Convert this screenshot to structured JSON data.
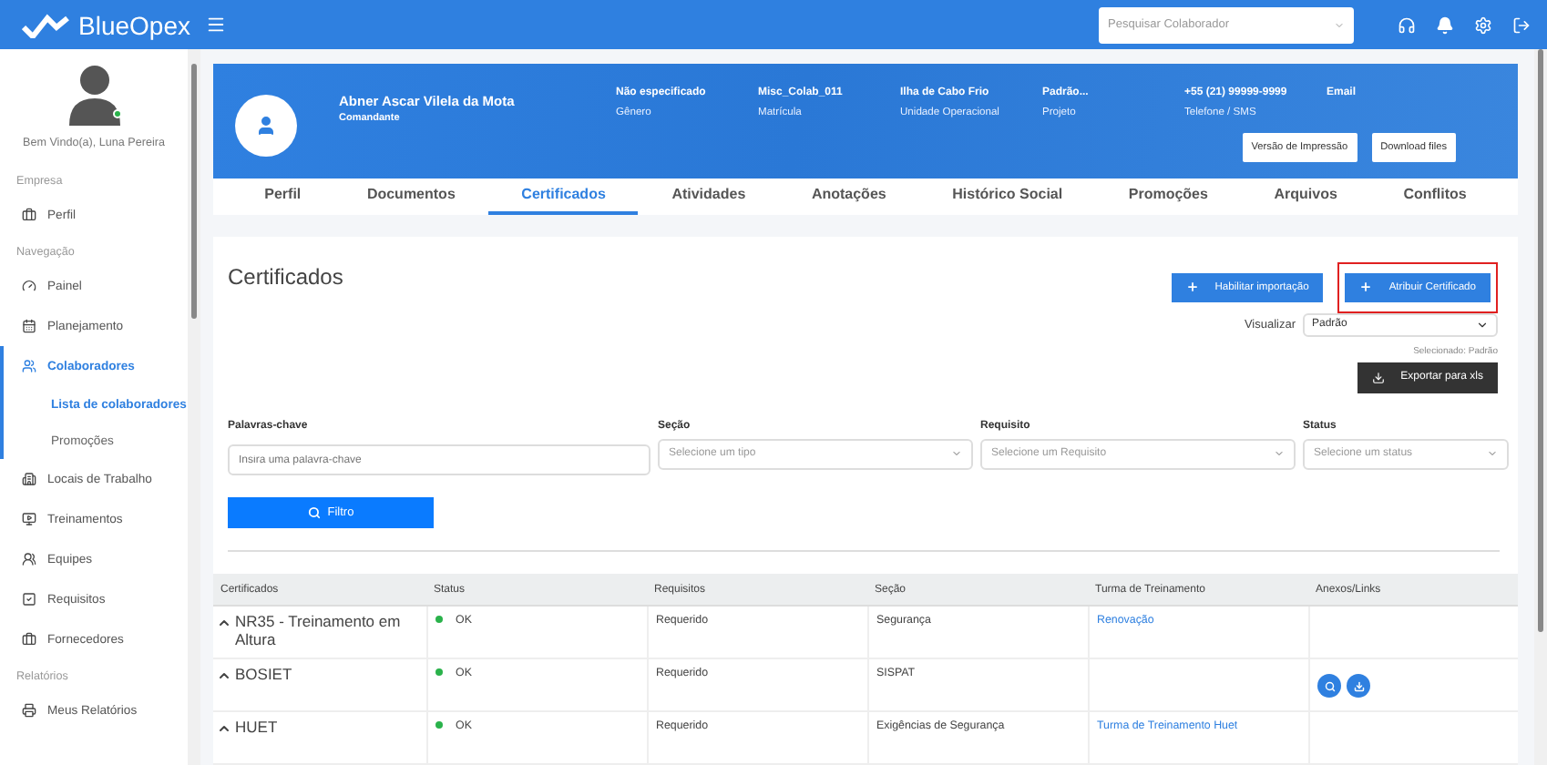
{
  "app": {
    "brand": "BlueOpex",
    "search": {
      "placeholder": "Pesquisar Colaborador"
    }
  },
  "sidebar": {
    "welcome": "Bem Vindo(a), Luna Pereira",
    "online": true,
    "sections": [
      {
        "title": "Empresa",
        "items": [
          {
            "label": "Perfil",
            "kind": "briefcase",
            "selected": false
          }
        ]
      },
      {
        "title": "Navegação",
        "items": [
          {
            "label": "Painel",
            "kind": "gauge",
            "selected": false
          },
          {
            "label": "Planejamento",
            "kind": "calendar",
            "selected": false
          },
          {
            "label": "Colaboradores",
            "kind": "users",
            "selected": true,
            "children": [
              {
                "label": "Lista de colaboradores",
                "selected": true
              },
              {
                "label": "Promoções",
                "selected": false
              }
            ]
          },
          {
            "label": "Locais de Trabalho",
            "kind": "building",
            "selected": false
          },
          {
            "label": "Treinamentos",
            "kind": "monitor",
            "selected": false
          },
          {
            "label": "Equipes",
            "kind": "team",
            "selected": false
          },
          {
            "label": "Requisitos",
            "kind": "check",
            "selected": false
          },
          {
            "label": "Fornecedores",
            "kind": "briefcase",
            "selected": false
          }
        ]
      },
      {
        "title": "Relatórios",
        "items": [
          {
            "label": "Meus Relatórios",
            "kind": "printer",
            "selected": false
          }
        ]
      }
    ]
  },
  "profile": {
    "name": "Abner Ascar Vilela da Mota",
    "role": "Comandante",
    "fields": [
      {
        "value": "Não especificado",
        "label": "Gênero"
      },
      {
        "value": "Misc_Colab_011",
        "label": "Matrícula"
      },
      {
        "value": "Ilha de Cabo Frio",
        "label": "Unidade Operacional"
      },
      {
        "value": "Padrão...",
        "label": "Projeto"
      },
      {
        "value": "+55 (21) 99999-9999",
        "label": "Telefone / SMS"
      },
      {
        "value": "Email"
      }
    ],
    "buttons": [
      "Versão de Impressão",
      "Download files"
    ]
  },
  "tabs": [
    {
      "label": "Perfil",
      "selected": false
    },
    {
      "label": "Documentos",
      "selected": false
    },
    {
      "label": "Certificados",
      "selected": true
    },
    {
      "label": "Atividades",
      "selected": false
    },
    {
      "label": "Anotações",
      "selected": false
    },
    {
      "label": "Histórico Social",
      "selected": false
    },
    {
      "label": "Promoções",
      "selected": false
    },
    {
      "label": "Arquivos",
      "selected": false
    },
    {
      "label": "Conflitos",
      "selected": false
    }
  ],
  "page": {
    "title": "Certificados",
    "actions": [
      {
        "label": "Habilitar importação",
        "highlighted": false
      },
      {
        "label": "Atribuir Certificado",
        "highlighted": true
      }
    ],
    "view": {
      "label": "Visualizar",
      "value": "Padrão",
      "note": "Selecionado: Padrão"
    },
    "export": "Exportar para xls",
    "filters": [
      {
        "label": "Palavras-chave",
        "placeholder": "Insira uma palavra-chave",
        "kind": "text"
      },
      {
        "label": "Seção",
        "placeholder": "Selecione um tipo",
        "kind": "select"
      },
      {
        "label": "Requisito",
        "placeholder": "Selecione um Requisito",
        "kind": "select"
      },
      {
        "label": "Status",
        "placeholder": "Selecione um status",
        "kind": "select"
      }
    ],
    "filter_button": "Filtro"
  },
  "table": {
    "columns": [
      "Certificados",
      "Status",
      "Requisitos",
      "Seção",
      "Turma de Treinamento",
      "Anexos/Links"
    ],
    "rows": [
      {
        "name": "NR35 - Treinamento em Altura",
        "status": "OK",
        "requirement": "Requerido",
        "section": "Segurança",
        "training": "Renovação",
        "attachments": []
      },
      {
        "name": "BOSIET",
        "status": "OK",
        "requirement": "Requerido",
        "section": "SISPAT",
        "attachments": [
          {
            "kind": "view"
          },
          {
            "kind": "download"
          }
        ]
      },
      {
        "name": "HUET",
        "status": "OK",
        "requirement": "Requerido",
        "section": "Exigências de Segurança",
        "training": "Turma de Treinamento Huet",
        "attachments": []
      }
    ]
  }
}
